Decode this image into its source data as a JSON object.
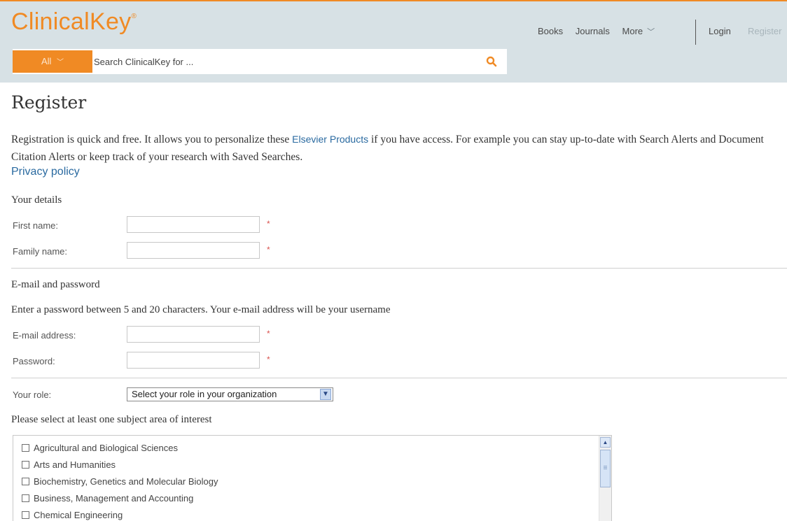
{
  "header": {
    "logo": "ClinicalKey",
    "nav": [
      "Books",
      "Journals",
      "More"
    ],
    "login": "Login",
    "register": "Register",
    "search": {
      "scope": "All",
      "placeholder": "Search ClinicalKey for ..."
    }
  },
  "page": {
    "title": "Register",
    "intro_part1": "Registration is quick and free. It allows you to personalize these ",
    "intro_link": "Elsevier Products",
    "intro_part2": " if you have access. For example you can stay up-to-date with Search Alerts and Document Citation Alerts or keep track of your research with Saved Searches.",
    "privacy": "Privacy policy"
  },
  "details": {
    "heading": "Your details",
    "first_name_label": "First name:",
    "family_name_label": "Family name:",
    "required_mark": "*"
  },
  "credentials": {
    "heading": "E-mail and password",
    "note": "Enter a password between 5 and 20 characters. Your e-mail address will be your username",
    "email_label": "E-mail address:",
    "password_label": "Password:"
  },
  "role": {
    "label": "Your role:",
    "selected": "Select your role in your organization"
  },
  "subjects": {
    "heading": "Please select at least one subject area of interest",
    "items": [
      "Agricultural and Biological Sciences",
      "Arts and Humanities",
      "Biochemistry, Genetics and Molecular Biology",
      "Business, Management and Accounting",
      "Chemical Engineering"
    ]
  },
  "colors": {
    "brand_orange": "#f08a24",
    "header_bg": "#d7e1e5",
    "link_blue": "#2a6aa0"
  }
}
